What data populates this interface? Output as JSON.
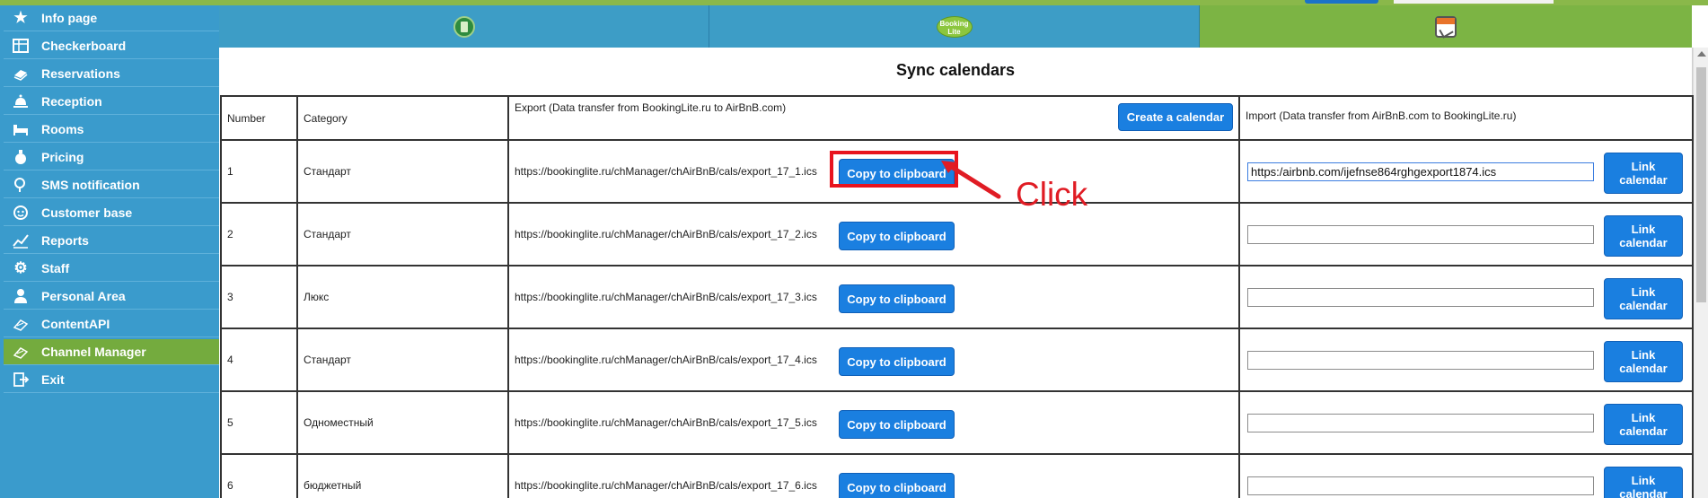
{
  "sidebar": {
    "items": [
      {
        "label": "Info page",
        "icon": "star-icon"
      },
      {
        "label": "Checkerboard",
        "icon": "grid-icon"
      },
      {
        "label": "Reservations",
        "icon": "book-icon"
      },
      {
        "label": "Reception",
        "icon": "bell-icon"
      },
      {
        "label": "Rooms",
        "icon": "bed-icon"
      },
      {
        "label": "Pricing",
        "icon": "money-bag-icon"
      },
      {
        "label": "SMS notification",
        "icon": "phone-icon"
      },
      {
        "label": "Customer base",
        "icon": "face-icon"
      },
      {
        "label": "Reports",
        "icon": "chart-icon"
      },
      {
        "label": "Staff",
        "icon": "gear-icon"
      },
      {
        "label": "Personal Area",
        "icon": "person-icon"
      },
      {
        "label": "ContentAPI",
        "icon": "api-icon"
      },
      {
        "label": "Channel Manager",
        "icon": "channel-icon",
        "active": true
      },
      {
        "label": "Exit",
        "icon": "exit-icon"
      }
    ]
  },
  "tabs": {
    "t2_logo_text_1": "Booking",
    "t2_logo_text_2": "Lite"
  },
  "page": {
    "title": "Sync calendars"
  },
  "table": {
    "headers": {
      "number": "Number",
      "category": "Category",
      "export": "Export (Data transfer from BookingLite.ru to AirBnB.com)",
      "import": "Import (Data transfer from AirBnB.com to BookingLite.ru)"
    },
    "create_button": "Create a calendar",
    "copy_button": "Copy to clipboard",
    "link_button_line1": "Link",
    "link_button_line2": "calendar",
    "rows": [
      {
        "number": "1",
        "category": "Стандарт",
        "export_url": "https://bookinglite.ru/chManager/chAirBnB/cals/export_17_1.ics",
        "import_value": "https:/airbnb.com/ijefnse864rghgexport1874.ics"
      },
      {
        "number": "2",
        "category": "Стандарт",
        "export_url": "https://bookinglite.ru/chManager/chAirBnB/cals/export_17_2.ics",
        "import_value": ""
      },
      {
        "number": "3",
        "category": "Люкс",
        "export_url": "https://bookinglite.ru/chManager/chAirBnB/cals/export_17_3.ics",
        "import_value": ""
      },
      {
        "number": "4",
        "category": "Стандарт",
        "export_url": "https://bookinglite.ru/chManager/chAirBnB/cals/export_17_4.ics",
        "import_value": ""
      },
      {
        "number": "5",
        "category": "Одноместный",
        "export_url": "https://bookinglite.ru/chManager/chAirBnB/cals/export_17_5.ics",
        "import_value": ""
      },
      {
        "number": "6",
        "category": "бюджетный",
        "export_url": "https://bookinglite.ru/chManager/chAirBnB/cals/export_17_6.ics",
        "import_value": ""
      }
    ]
  },
  "annotation": {
    "label": "Click",
    "color": "#e01c24"
  },
  "colors": {
    "sidebar": "#3a9bcc",
    "active": "#74ab3e",
    "button": "#1a7fe0"
  }
}
